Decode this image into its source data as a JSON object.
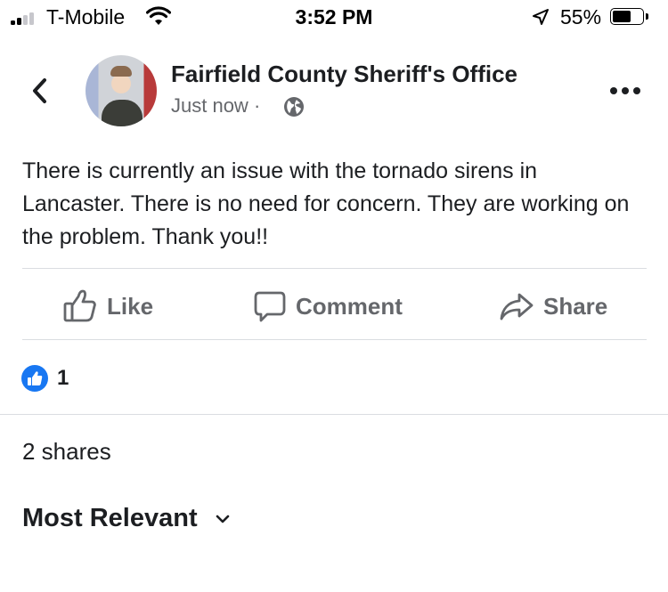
{
  "status_bar": {
    "carrier": "T-Mobile",
    "time": "3:52 PM",
    "battery_percent": "55%",
    "battery_level": 0.55,
    "signal_bars_active": 2,
    "signal_bars_total": 4
  },
  "post": {
    "page_name": "Fairfield County Sheriff's Office",
    "timestamp": "Just now",
    "separator": "·",
    "privacy_icon": "globe-icon",
    "body": "There is currently an issue with the tornado sirens in Lancaster. There is no need for concern. They are working on the problem.  Thank you!!"
  },
  "actions": {
    "like_label": "Like",
    "comment_label": "Comment",
    "share_label": "Share"
  },
  "engagement": {
    "reaction_count": "1",
    "shares_text": "2 shares"
  },
  "comments": {
    "sort_label": "Most Relevant"
  },
  "colors": {
    "text": "#1c1e21",
    "secondary_text": "#65676b",
    "divider": "#dadde1",
    "like_blue": "#1877f2"
  }
}
